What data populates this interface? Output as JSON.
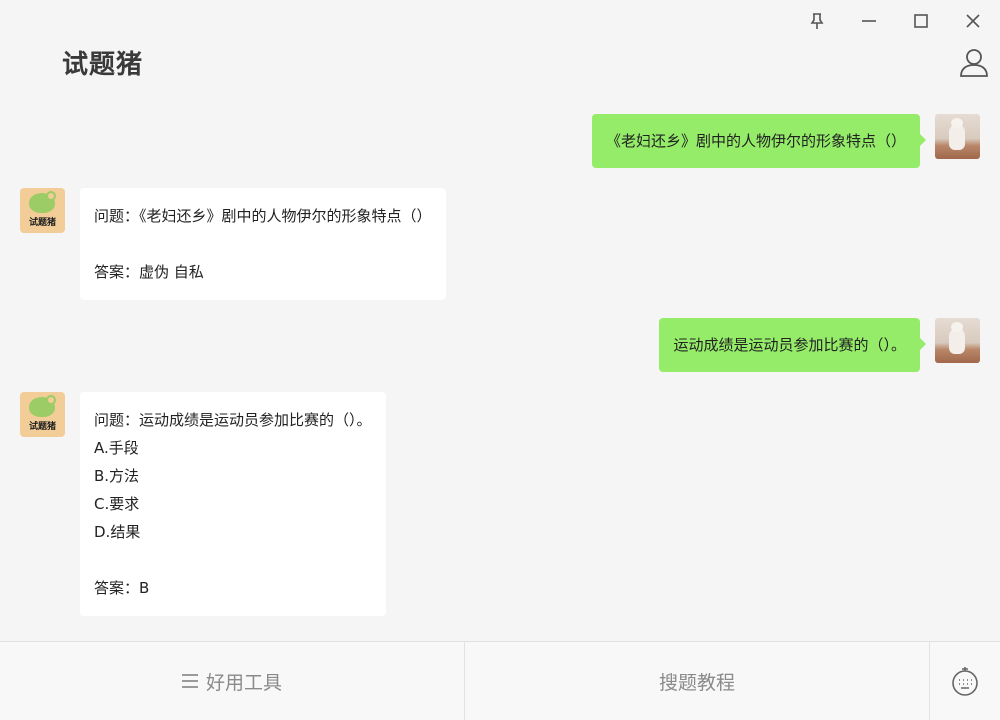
{
  "window": {
    "title": "试题猪",
    "controls": [
      "pin-icon",
      "minimize-icon",
      "maximize-icon",
      "close-icon"
    ]
  },
  "header": {
    "user_icon": "user-icon"
  },
  "messages": [
    {
      "from": "user",
      "text": "《老妇还乡》剧中的人物伊尔的形象特点（）"
    },
    {
      "from": "bot",
      "avatar_label": "试题猪",
      "question": "问题：《老妇还乡》剧中的人物伊尔的形象特点（）",
      "options": [],
      "answer": "答案：虚伪 自私"
    },
    {
      "from": "user",
      "text": "运动成绩是运动员参加比赛的（）。"
    },
    {
      "from": "bot",
      "avatar_label": "试题猪",
      "question": "问题：运动成绩是运动员参加比赛的（）。",
      "options": [
        "A.手段",
        "B.方法",
        "C.要求",
        "D.结果"
      ],
      "answer": "答案：B"
    }
  ],
  "bottom_bar": {
    "tools_label": "好用工具",
    "tutorial_label": "搜题教程",
    "keyboard_icon": "keyboard-icon"
  },
  "colors": {
    "background": "#f5f5f5",
    "user_bubble": "#95ec69",
    "bot_bubble": "#ffffff",
    "bot_avatar": "#f2cd97"
  }
}
